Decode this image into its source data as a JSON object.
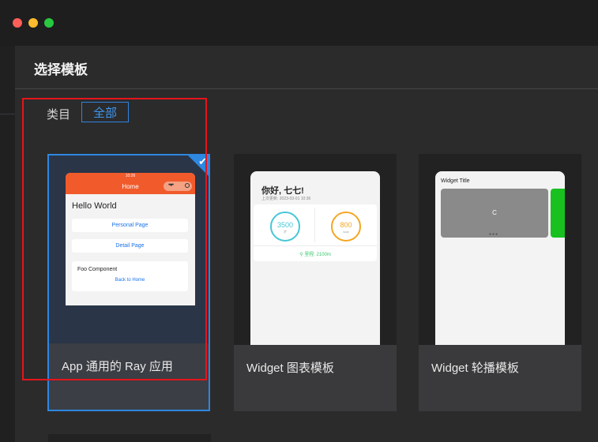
{
  "modal": {
    "title": "选择模板"
  },
  "category": {
    "label": "类目",
    "selected": "全部"
  },
  "templates": [
    {
      "label": "App 通用的 Ray 应用",
      "selected": true,
      "preview": {
        "status_time": "10:26",
        "nav_title": "Home",
        "heading": "Hello World",
        "buttons": [
          "Personal Page",
          "Detail Page"
        ],
        "component_title": "Foo Component",
        "component_link": "Back to Home"
      }
    },
    {
      "label": "Widget 图表模板",
      "selected": false,
      "preview": {
        "greeting": "你好, 七七!",
        "updated": "上次更新: 2023-03-01 10:36",
        "metrics": [
          {
            "value": "3500",
            "unit": "步"
          },
          {
            "value": "800",
            "unit": "kcal"
          }
        ],
        "distance": "里程: 2100m"
      }
    },
    {
      "label": "Widget 轮播模板",
      "selected": false,
      "preview": {
        "title": "Widget Title",
        "slide_label": "C",
        "dots": "●●●"
      }
    }
  ],
  "colors": {
    "accent": "#2e87e0",
    "highlight": "#e6141a",
    "app_primary": "#f15a2b"
  }
}
